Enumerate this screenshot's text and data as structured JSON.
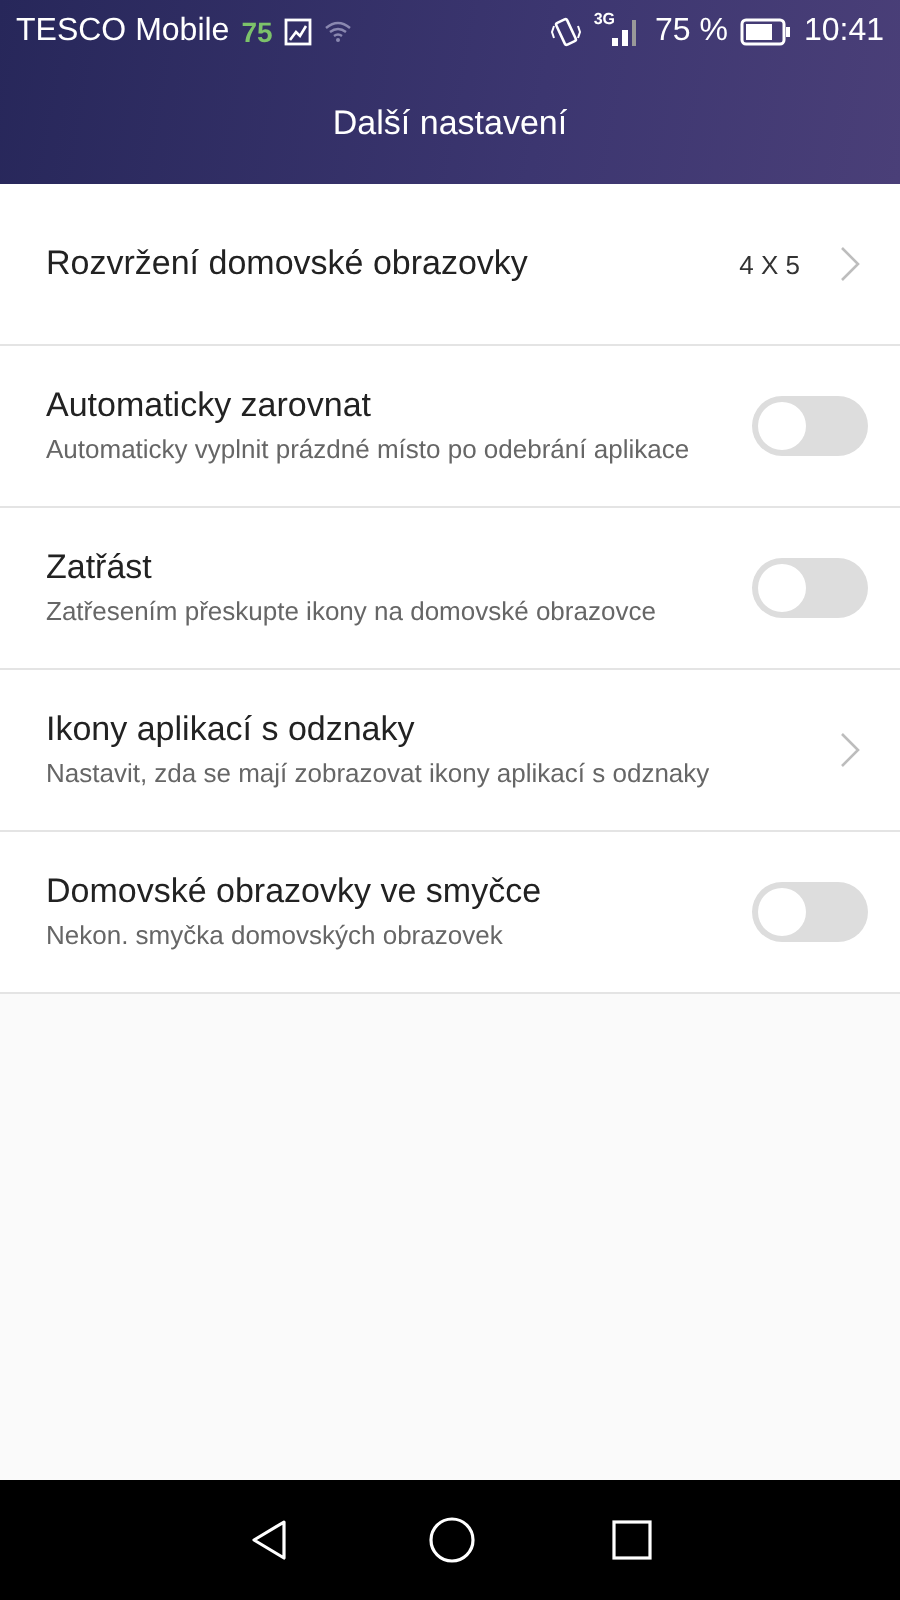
{
  "status_bar": {
    "carrier": "TESCO Mobile",
    "carrier_badge": "75",
    "network": "3G",
    "battery": "75 %",
    "time": "10:41"
  },
  "title": "Další nastavení",
  "settings": [
    {
      "kind": "link",
      "title": "Rozvržení domovské obrazovky",
      "value": "4 X 5"
    },
    {
      "kind": "switch",
      "title": "Automaticky zarovnat",
      "subtitle": "Automaticky vyplnit prázdné místo po odebrání aplikace",
      "on": false
    },
    {
      "kind": "switch",
      "title": "Zatřást",
      "subtitle": "Zatřesením přeskupte ikony na domovské obrazovce",
      "on": false
    },
    {
      "kind": "link",
      "title": "Ikony aplikací s odznaky",
      "subtitle": "Nastavit, zda se mají zobrazovat ikony aplikací s odznaky"
    },
    {
      "kind": "switch",
      "title": "Domovské obrazovky ve smyčce",
      "subtitle": "Nekon. smyčka domovských obrazovek",
      "on": false
    }
  ]
}
